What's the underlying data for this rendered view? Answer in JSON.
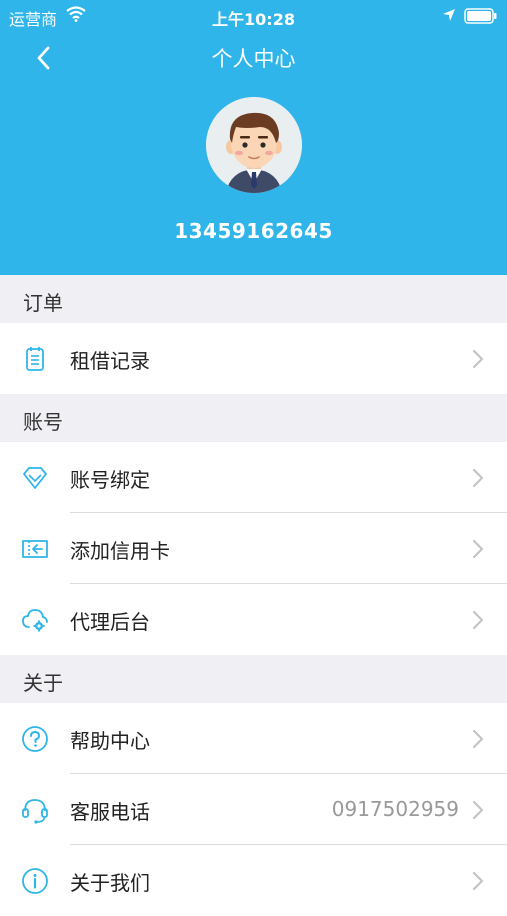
{
  "status_bar": {
    "carrier": "运营商",
    "time": "上午10:28"
  },
  "header": {
    "title": "个人中心",
    "phone": "13459162645"
  },
  "sections": [
    {
      "title": "订单",
      "items": [
        {
          "label": "租借记录",
          "icon": "notepad-icon"
        }
      ]
    },
    {
      "title": "账号",
      "items": [
        {
          "label": "账号绑定",
          "icon": "diamond-icon"
        },
        {
          "label": "添加信用卡",
          "icon": "card-icon"
        },
        {
          "label": "代理后台",
          "icon": "cloud-gear-icon"
        }
      ]
    },
    {
      "title": "关于",
      "items": [
        {
          "label": "帮助中心",
          "icon": "question-icon"
        },
        {
          "label": "客服电话",
          "icon": "headset-icon",
          "value": "0917502959"
        },
        {
          "label": "关于我们",
          "icon": "info-icon"
        }
      ]
    }
  ],
  "colors": {
    "header_bg": "#2fb5ea",
    "icon": "#2fb5ea",
    "page_bg": "#efeff4"
  }
}
